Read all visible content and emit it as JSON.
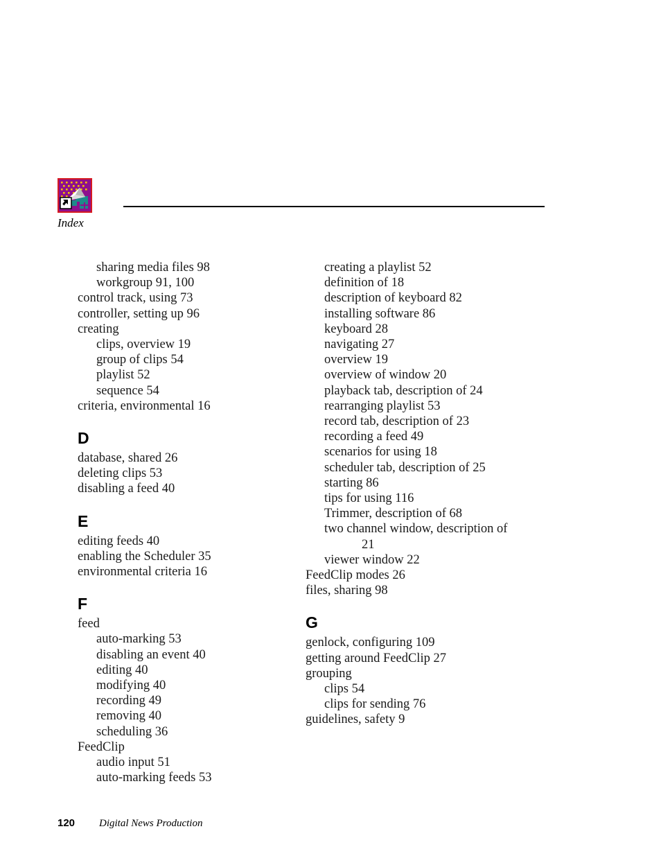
{
  "document": {
    "header": {
      "icon_name": "chapter-icon",
      "icon_colors": {
        "border": "#d61a20",
        "background": "#8e0f8e",
        "dots": "#f2c200",
        "plane": "#f4f4f4",
        "plane_shadow": "#a9a9a9",
        "blocks": "#1d8a8a",
        "arrow_box": "#ffffff",
        "arrow": "#000000"
      },
      "label": "Index"
    },
    "footer": {
      "page_number": "120",
      "title": "Digital News Production"
    },
    "columns": [
      {
        "name": "left-column",
        "sections": [
          {
            "letter": "",
            "entries": [
              {
                "level": 2,
                "text": "sharing media files 98"
              },
              {
                "level": 2,
                "text": "workgroup 91, 100"
              },
              {
                "level": 1,
                "text": "control track, using 73"
              },
              {
                "level": 1,
                "text": "controller, setting up 96"
              },
              {
                "level": 1,
                "text": "creating"
              },
              {
                "level": 2,
                "text": "clips, overview 19"
              },
              {
                "level": 2,
                "text": "group of clips 54"
              },
              {
                "level": 2,
                "text": "playlist 52"
              },
              {
                "level": 2,
                "text": "sequence 54"
              },
              {
                "level": 1,
                "text": "criteria, environmental 16"
              }
            ]
          },
          {
            "letter": "D",
            "entries": [
              {
                "level": 1,
                "text": "database, shared 26"
              },
              {
                "level": 1,
                "text": "deleting clips 53"
              },
              {
                "level": 1,
                "text": "disabling a feed 40"
              }
            ]
          },
          {
            "letter": "E",
            "entries": [
              {
                "level": 1,
                "text": "editing feeds 40"
              },
              {
                "level": 1,
                "text": "enabling the Scheduler 35"
              },
              {
                "level": 1,
                "text": "environmental criteria 16"
              }
            ]
          },
          {
            "letter": "F",
            "entries": [
              {
                "level": 1,
                "text": "feed"
              },
              {
                "level": 2,
                "text": "auto-marking 53"
              },
              {
                "level": 2,
                "text": "disabling an event 40"
              },
              {
                "level": 2,
                "text": "editing 40"
              },
              {
                "level": 2,
                "text": "modifying 40"
              },
              {
                "level": 2,
                "text": "recording 49"
              },
              {
                "level": 2,
                "text": "removing 40"
              },
              {
                "level": 2,
                "text": "scheduling 36"
              },
              {
                "level": 1,
                "text": "FeedClip"
              },
              {
                "level": 2,
                "text": "audio input 51"
              },
              {
                "level": 2,
                "text": "auto-marking feeds 53"
              }
            ]
          }
        ]
      },
      {
        "name": "right-column",
        "sections": [
          {
            "letter": "",
            "entries": [
              {
                "level": 2,
                "text": "creating a playlist 52"
              },
              {
                "level": 2,
                "text": "definition of 18"
              },
              {
                "level": 2,
                "text": "description of keyboard 82"
              },
              {
                "level": 2,
                "text": "installing software 86"
              },
              {
                "level": 2,
                "text": "keyboard 28"
              },
              {
                "level": 2,
                "text": "navigating 27"
              },
              {
                "level": 2,
                "text": "overview 19"
              },
              {
                "level": 2,
                "text": "overview of window 20"
              },
              {
                "level": 2,
                "text": "playback tab, description of 24"
              },
              {
                "level": 2,
                "text": "rearranging playlist 53"
              },
              {
                "level": 2,
                "text": "record tab, description of 23"
              },
              {
                "level": 2,
                "text": "recording a feed 49"
              },
              {
                "level": 2,
                "text": "scenarios for using 18"
              },
              {
                "level": 2,
                "text": "scheduler tab, description of 25"
              },
              {
                "level": 2,
                "text": "starting 86"
              },
              {
                "level": 2,
                "text": "tips for using 116"
              },
              {
                "level": 2,
                "text": "Trimmer, description of 68"
              },
              {
                "level": 2,
                "wrap": true,
                "text": "two channel window, description of",
                "continuation": "21"
              },
              {
                "level": 2,
                "text": "viewer window 22"
              },
              {
                "level": 1,
                "text": "FeedClip modes 26"
              },
              {
                "level": 1,
                "text": "files, sharing 98"
              }
            ]
          },
          {
            "letter": "G",
            "entries": [
              {
                "level": 1,
                "text": "genlock, configuring 109"
              },
              {
                "level": 1,
                "text": "getting around FeedClip 27"
              },
              {
                "level": 1,
                "text": "grouping"
              },
              {
                "level": 2,
                "text": "clips 54"
              },
              {
                "level": 2,
                "text": "clips for sending 76"
              },
              {
                "level": 1,
                "text": "guidelines, safety 9"
              }
            ]
          }
        ]
      }
    ]
  }
}
